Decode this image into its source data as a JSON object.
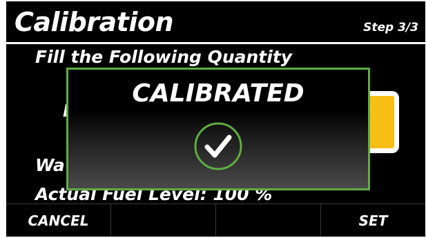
{
  "header": {
    "title": "Calibration",
    "step": "Step 3/3"
  },
  "body": {
    "instruction": "Fill the Following Quantity",
    "partial_line": "F",
    "wa_line": "Wa",
    "actual_line": "Actual Fuel Level: 100 %"
  },
  "dialog": {
    "title": "CALIBRATED",
    "icon": "checkmark-circle-icon"
  },
  "footer": {
    "cancel": "CANCEL",
    "slot2": "",
    "slot3": "",
    "set": "SET"
  },
  "colors": {
    "accent_green": "#5fae42",
    "fuel_yellow": "#f7be16",
    "background": "#000000",
    "text": "#ffffff"
  }
}
